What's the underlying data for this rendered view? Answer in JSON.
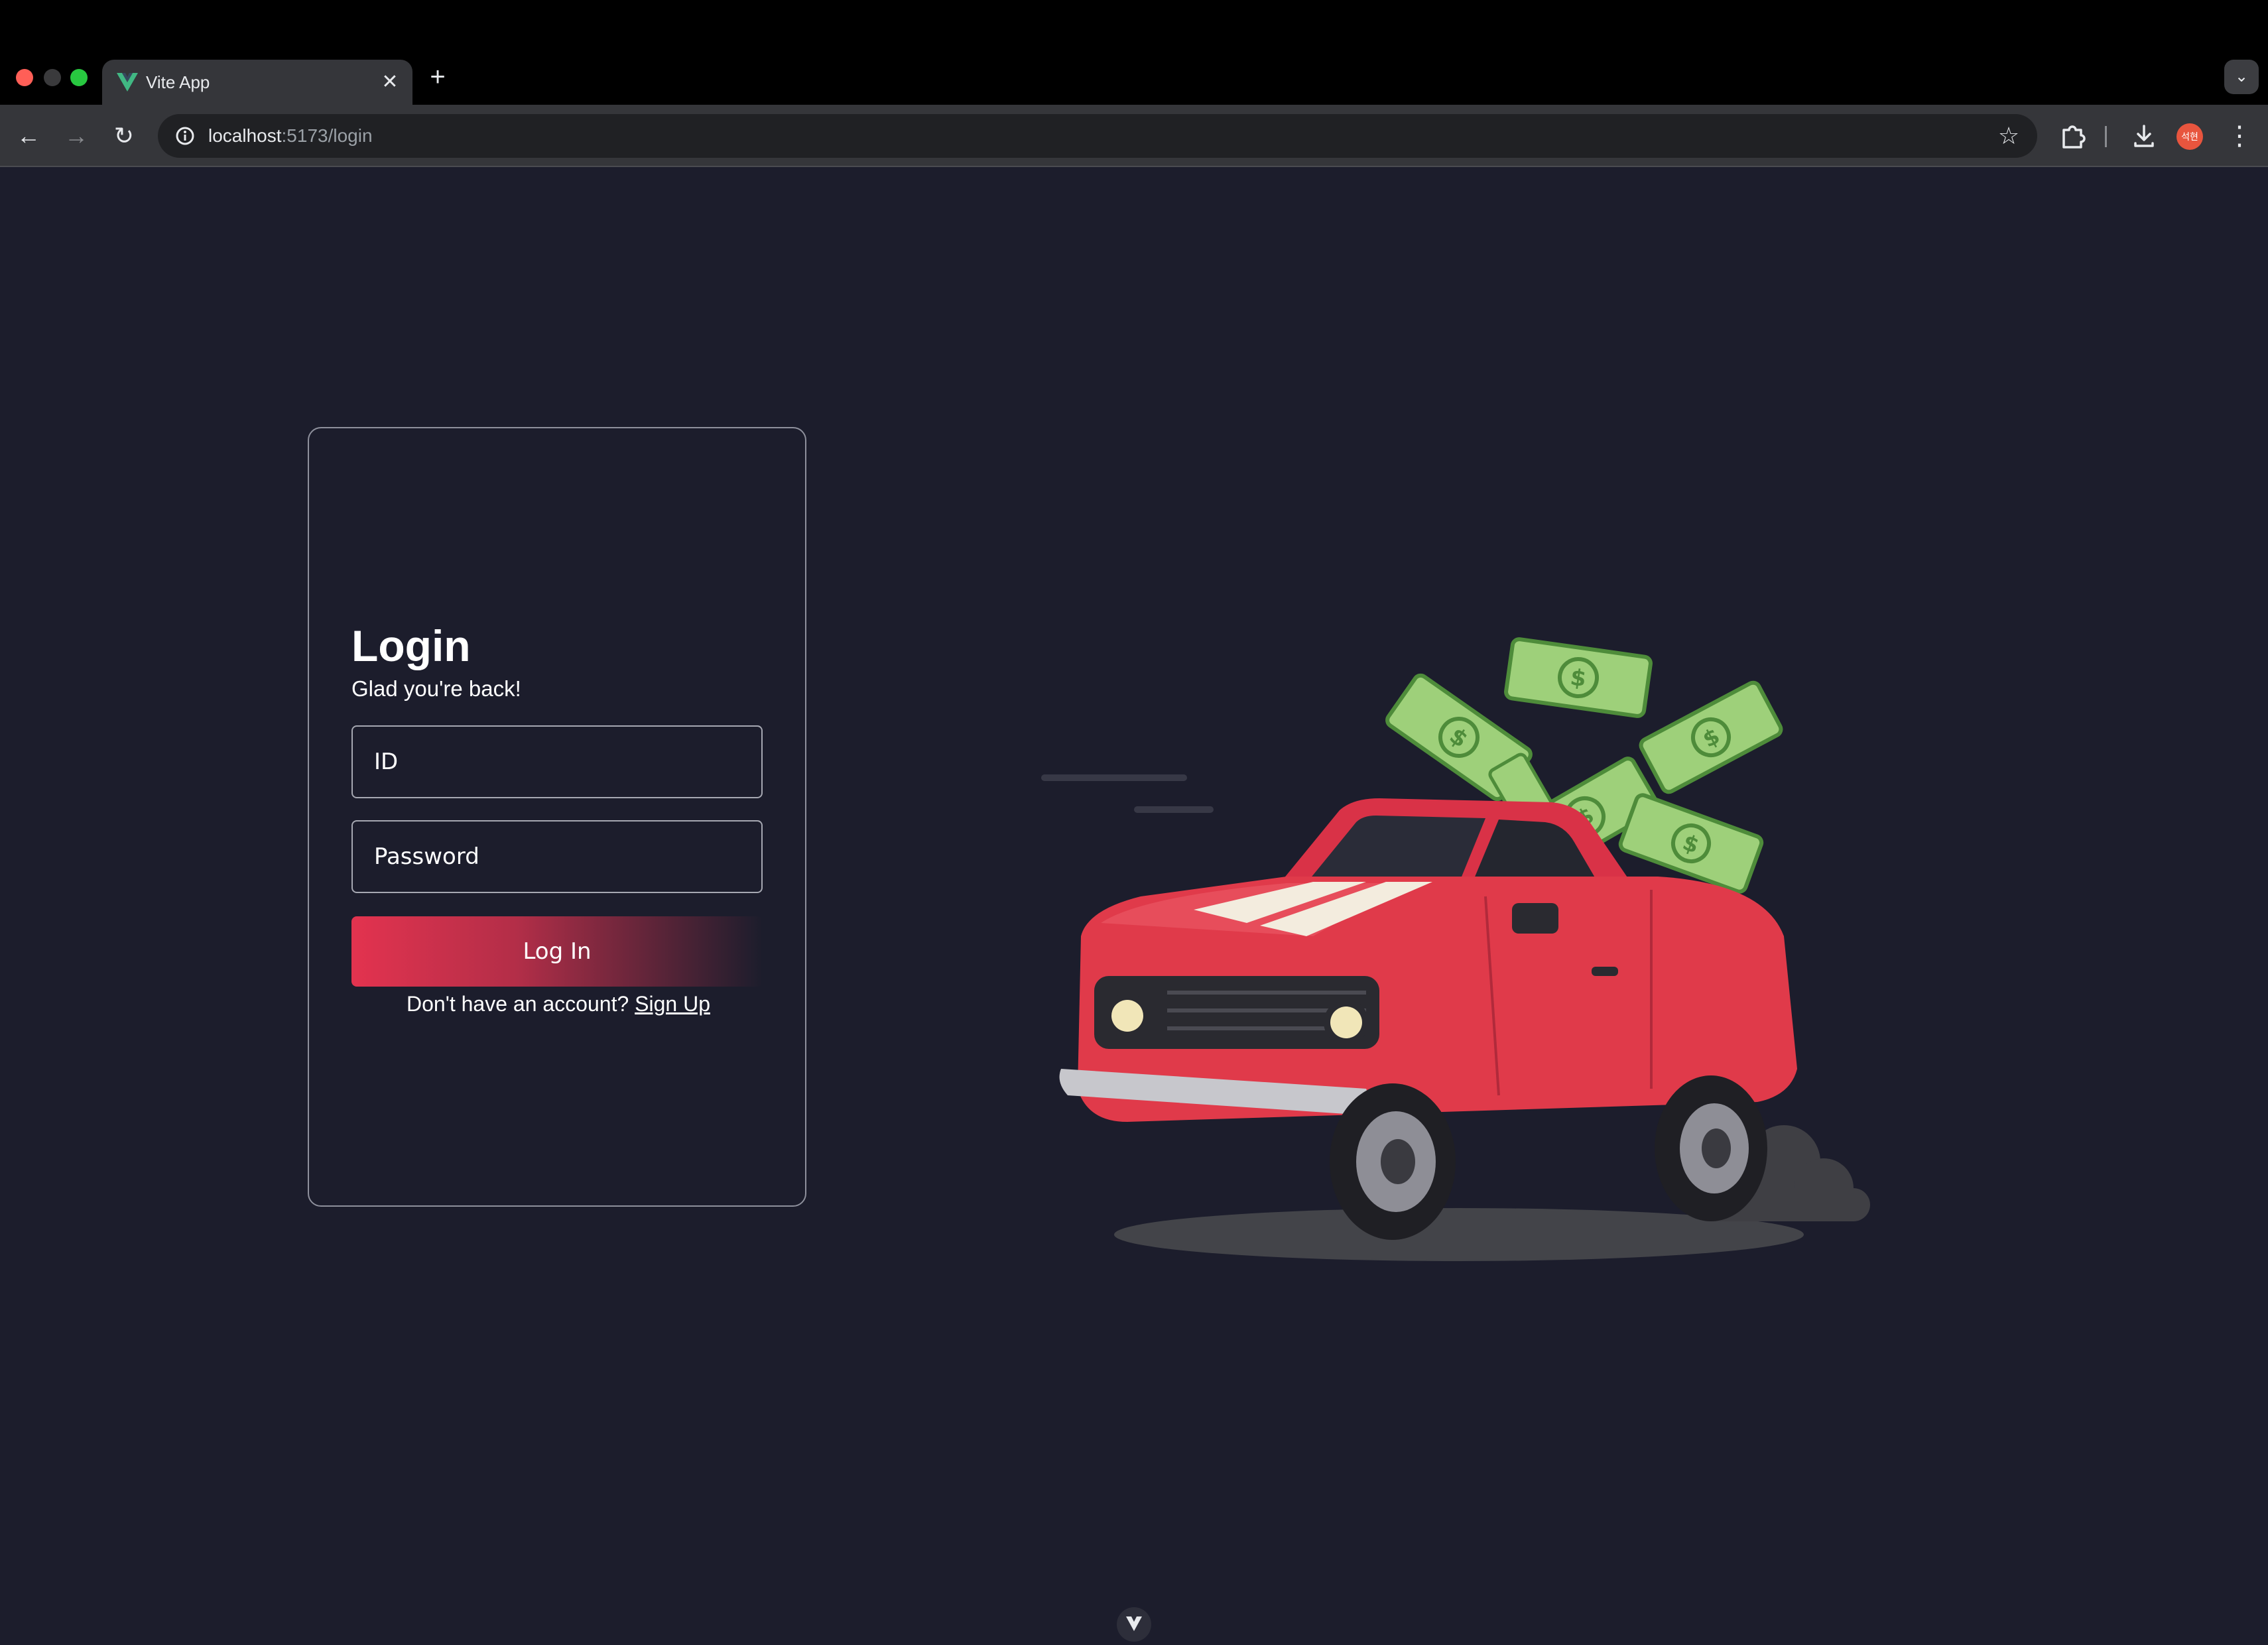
{
  "browser": {
    "tab": {
      "title": "Vite App",
      "favicon": "vue-logo-icon",
      "close_glyph": "✕"
    },
    "new_tab_glyph": "+",
    "tab_search_glyph": "⌄",
    "nav": {
      "back_glyph": "←",
      "forward_glyph": "→",
      "reload_glyph": "↻"
    },
    "url": {
      "host": "localhost",
      "path": ":5173/login"
    },
    "star_glyph": "☆",
    "profile_label": "석현",
    "menu_glyph": "⋮",
    "colors": {
      "tab_strip": "#000000",
      "toolbar": "#35363a",
      "omnibox": "#202124"
    }
  },
  "page": {
    "background": "#1c1d2c",
    "login_card": {
      "title": "Login",
      "subtitle": "Glad you're back!",
      "id_placeholder": "ID",
      "password_placeholder": "Password",
      "login_button": "Log In",
      "signup_prompt": "Don't have an account?",
      "signup_link": "Sign Up",
      "accent_color": "#e3334f"
    },
    "illustration": {
      "subject": "red-car-with-flying-money",
      "car_color": "#e03a4a",
      "money_color": "#9ed07a"
    }
  }
}
